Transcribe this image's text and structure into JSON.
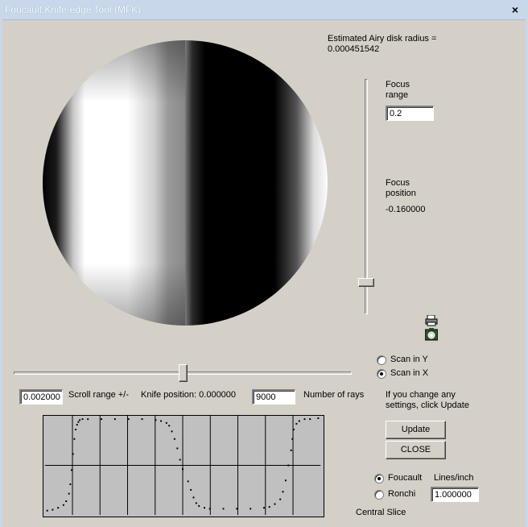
{
  "window": {
    "title": "Foucault Knife-edge Tool (MFK)",
    "close_glyph": "×"
  },
  "airy": {
    "label": "Estimated Airy disk radius =",
    "value": "0.000451542"
  },
  "focus_range": {
    "label_line1": "Focus",
    "label_line2": "range",
    "value": "0.2"
  },
  "focus_position": {
    "label_line1": "Focus",
    "label_line2": "position",
    "value": "-0.160000"
  },
  "focus_slider": {
    "level": 0.88
  },
  "knife_slider": {
    "level": 0.5
  },
  "icons": {
    "printer": "printer-icon",
    "camera": "camera-icon"
  },
  "scan": {
    "y_label": "Scan in Y",
    "x_label": "Scan in X",
    "selected": "x"
  },
  "controls": {
    "scroll_range_value": "0.002000",
    "scroll_range_label": "Scroll range +/-",
    "knife_position_label": "Knife position: 0.000000",
    "rays_value": "9000",
    "rays_label": "Number of rays"
  },
  "notice": {
    "line1": "If you change any",
    "line2": "settings, click Update"
  },
  "buttons": {
    "update": "Update",
    "close": "CLOSE"
  },
  "mode": {
    "foucault_label": "Foucault",
    "ronchi_label": "Ronchi",
    "selected": "foucault",
    "lines_label": "Lines/inch",
    "lines_value": "1.000000"
  },
  "slice": {
    "label": "Central Slice"
  },
  "chart_data": {
    "type": "scatter",
    "title": "Central Slice",
    "xlabel": "",
    "ylabel": "",
    "xlim": [
      0,
      1
    ],
    "ylim": [
      0,
      1
    ],
    "grid": true,
    "grid_divisions": {
      "x": 10,
      "y": 2
    },
    "x": [
      0.0,
      0.02,
      0.04,
      0.06,
      0.07,
      0.08,
      0.085,
      0.09,
      0.095,
      0.1,
      0.105,
      0.11,
      0.115,
      0.12,
      0.13,
      0.15,
      0.2,
      0.25,
      0.3,
      0.35,
      0.4,
      0.42,
      0.44,
      0.45,
      0.46,
      0.47,
      0.48,
      0.49,
      0.5,
      0.52,
      0.53,
      0.54,
      0.55,
      0.56,
      0.58,
      0.6,
      0.65,
      0.7,
      0.75,
      0.8,
      0.82,
      0.84,
      0.86,
      0.87,
      0.88,
      0.89,
      0.9,
      0.905,
      0.91,
      0.92,
      0.93,
      0.95,
      0.97,
      1.0
    ],
    "y": [
      0.02,
      0.03,
      0.05,
      0.08,
      0.12,
      0.2,
      0.3,
      0.45,
      0.62,
      0.78,
      0.88,
      0.93,
      0.96,
      0.98,
      0.99,
      0.99,
      0.99,
      0.99,
      0.99,
      0.99,
      0.98,
      0.97,
      0.95,
      0.92,
      0.86,
      0.78,
      0.68,
      0.56,
      0.46,
      0.33,
      0.24,
      0.16,
      0.1,
      0.07,
      0.05,
      0.04,
      0.04,
      0.04,
      0.04,
      0.05,
      0.06,
      0.09,
      0.14,
      0.22,
      0.34,
      0.5,
      0.66,
      0.78,
      0.88,
      0.94,
      0.97,
      0.99,
      0.99,
      1.0
    ],
    "point_color": "#000000",
    "background": "#c0c0c0"
  }
}
